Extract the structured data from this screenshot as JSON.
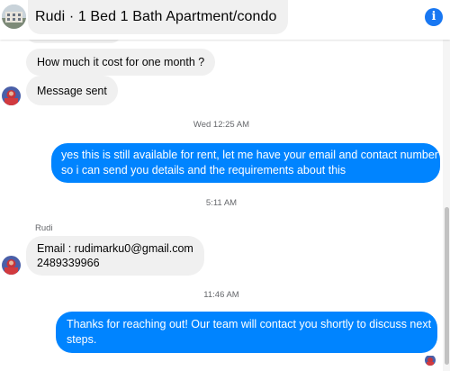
{
  "header": {
    "title": "Rudi · 1 Bed 1 Bath Apartment/condo",
    "info_icon": "info-icon",
    "accent_color": "#1877f2"
  },
  "messages": {
    "msg1": "How much it cost for one month ?",
    "msg2": "Message sent",
    "stamp1": "Wed 12:25 AM",
    "out1_line1": "yes this is still available for rent, let me have your email  and contact number",
    "out1_line2": "so i can send you details and the requirements about this",
    "stamp2": "5:11 AM",
    "sender_label": "Rudi",
    "msg3_line1": "Email : rudimarku0@gmail.com",
    "msg3_line2": "2489339966",
    "stamp3": "11:46 AM",
    "out2_line1": "Thanks for reaching out! Our team will contact you shortly to discuss next",
    "out2_line2": "steps."
  },
  "colors": {
    "incoming_bubble": "#f0f0f0",
    "outgoing_bubble": "#0084ff",
    "timestamp": "#65676b"
  }
}
